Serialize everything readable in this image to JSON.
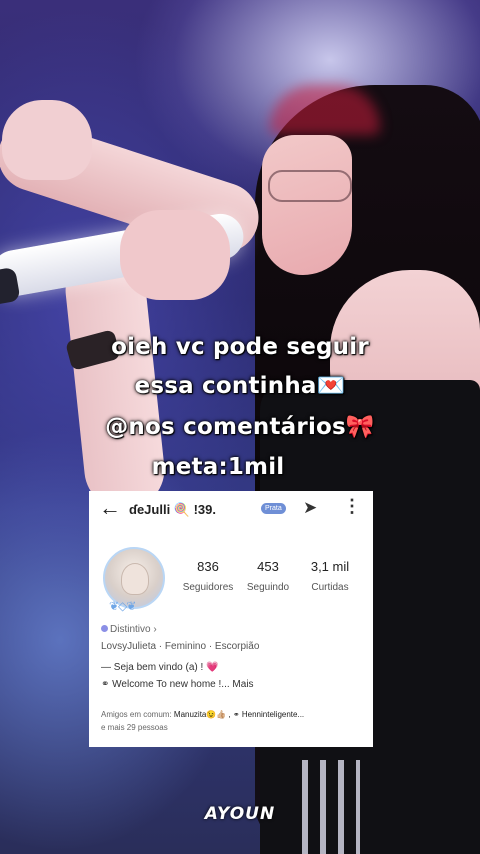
{
  "caption": {
    "line1": "oieh vc pode seguir",
    "line2": "essa continha💌",
    "line3": "@nos comentários🎀",
    "line4": "meta:1mil"
  },
  "profile": {
    "username": "ɗeJulli 🍭 !39.",
    "badge": "Prata",
    "stats": [
      {
        "value": "836",
        "label": "Seguidores"
      },
      {
        "value": "453",
        "label": "Seguindo"
      },
      {
        "value": "3,1 mil",
        "label": "Curtidas"
      }
    ],
    "distintivo": "Distintivo ›",
    "meta": "LovsyJulieta · Feminino · Escorpião",
    "bio_line1": "— Seja bem vindo (a) ! ",
    "bio_heart": "💗",
    "bio_line2": "Welcome To new home !...",
    "bio_more": "Mais",
    "friends_prefix": "Amigos em comum: ",
    "friends_names": "Manuzita😉👍🏼 ,  ⚭ Henninteligente... ",
    "friends_suffix": "e mais 29 pessoas"
  },
  "watermark": "AYOUN",
  "icons": [
    "back-arrow-icon",
    "share-icon",
    "more-options-icon"
  ]
}
